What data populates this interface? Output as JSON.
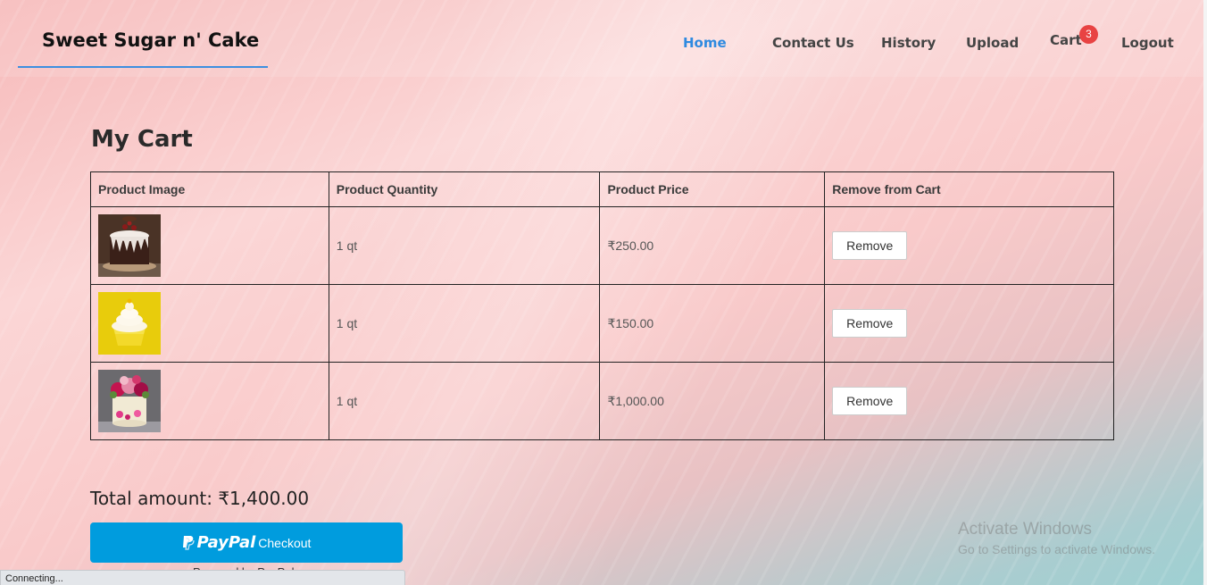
{
  "brand": {
    "name": "Sweet Sugar n' Cake"
  },
  "nav": {
    "home": "Home",
    "contact": "Contact Us",
    "history": "History",
    "upload": "Upload",
    "cart": "Cart",
    "cart_count": "3",
    "logout": "Logout"
  },
  "page": {
    "title": "My Cart"
  },
  "table": {
    "headers": [
      "Product Image",
      "Product Quantity",
      "Product Price",
      "Remove from Cart"
    ],
    "rows": [
      {
        "image": "chocolate-cake-image",
        "quantity": "1 qt",
        "price": "₹250.00",
        "action": "Remove"
      },
      {
        "image": "lemon-cupcake-image",
        "quantity": "1 qt",
        "price": "₹150.00",
        "action": "Remove"
      },
      {
        "image": "floral-cake-image",
        "quantity": "1 qt",
        "price": "₹1,000.00",
        "action": "Remove"
      }
    ]
  },
  "summary": {
    "total": "Total amount: ₹1,400.00"
  },
  "paypal": {
    "logo": "PayPal",
    "label": "Checkout",
    "subtext": "Powered by PayPal"
  },
  "watermark": {
    "title": "Activate Windows",
    "subtitle": "Go to Settings to activate Windows."
  },
  "status": {
    "text": "Connecting..."
  },
  "colors": {
    "accent": "#2f8ae0",
    "badge": "#e84343",
    "paypal": "#009cde"
  }
}
